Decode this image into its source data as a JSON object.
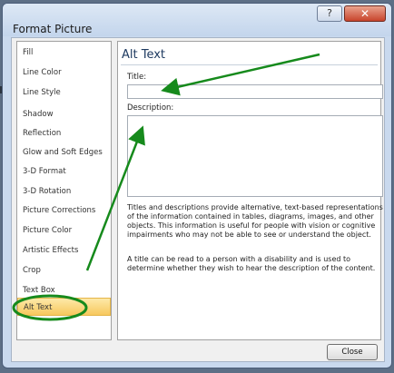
{
  "window": {
    "title": "Format Picture",
    "help_glyph": "?",
    "close_glyph": "✕"
  },
  "nav": {
    "items": [
      {
        "label": "Fill"
      },
      {
        "label": "Line Color"
      },
      {
        "label": "Line Style"
      },
      {
        "label": "Shadow"
      },
      {
        "label": "Reflection"
      },
      {
        "label": "Glow and Soft Edges"
      },
      {
        "label": "3-D Format"
      },
      {
        "label": "3-D Rotation"
      },
      {
        "label": "Picture Corrections"
      },
      {
        "label": "Picture Color"
      },
      {
        "label": "Artistic Effects"
      },
      {
        "label": "Crop"
      },
      {
        "label": "Text Box"
      },
      {
        "label": "Alt Text"
      }
    ],
    "selected": "Alt Text"
  },
  "panel": {
    "heading": "Alt Text",
    "title_label": "Title:",
    "title_value": "",
    "description_label": "Description:",
    "description_value": "",
    "help_paragraph_1": "Titles and descriptions provide alternative, text-based representations of the information contained in tables, diagrams, images, and other objects. This information is useful for people with vision or cognitive impairments who may not be able to see or understand the object.",
    "help_paragraph_2": "A title can be read to a person with a disability and is used to determine whether they wish to hear the description of the content."
  },
  "footer": {
    "close_label": "Close"
  },
  "annotation": {
    "color": "#168a1c"
  },
  "colors": {
    "selected_bg": "#f7c85e",
    "dialog_bg": "#c9d9ee"
  }
}
